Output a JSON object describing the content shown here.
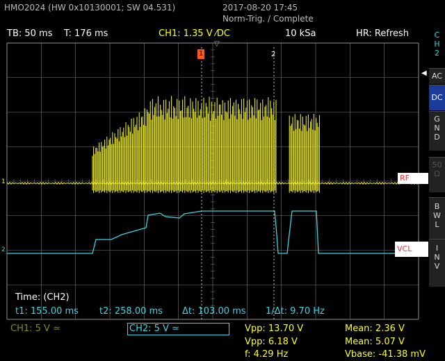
{
  "header": {
    "device": "HMO2024 (HW 0x10130001; SW 04.531)",
    "datetime": "2017-08-20 17:45",
    "status": "Norm-Trig. / Complete"
  },
  "topbar": {
    "timebase": "TB: 50 ms",
    "trigger_time": "T: 176 ms",
    "ch1": "CH1: 1.35 V ⁄DC",
    "samplerate": "10 kSa",
    "mode": "HR: Refresh"
  },
  "side_menu": {
    "channel_label": [
      "C",
      "H",
      "2"
    ],
    "ac": "AC",
    "dc": "DC",
    "gnd": [
      "G",
      "N",
      "D"
    ],
    "ohm": [
      "50",
      "Ω"
    ],
    "bwl": [
      "B",
      "W",
      "L"
    ],
    "inv": [
      "I",
      "N",
      "V"
    ]
  },
  "markers": {
    "trigger_marker": "1",
    "cursor2_marker": "2",
    "ch1_level": "1",
    "ch2_level": "2"
  },
  "tags": {
    "rf": "RF",
    "vcl": "VCL"
  },
  "cursor_readout": {
    "title": "Time: (CH2)",
    "t1": "t1: 155.00 ms",
    "t2": "t2: 258.00 ms",
    "dt": "Δt: 103.00 ms",
    "inv_dt": "1/Δt: 9.70 Hz"
  },
  "bottom": {
    "ch1_scale": "CH1: 5 V ≃",
    "ch2_scale": "CH2: 5 V ≃",
    "vpp1": "Vpp: 13.70 V",
    "vpp2": "Vpp: 6.18 V",
    "freq": "f: 4.29 Hz",
    "mean1": "Mean: 2.36 V",
    "mean2": "Mean: 5.07 V",
    "vbase": "Vbase: -41.38 mV"
  },
  "colors": {
    "ch1": "#ffff1e",
    "ch2": "#3ad7e6",
    "grid": "#777777",
    "active_button": "#1b3a9c"
  }
}
